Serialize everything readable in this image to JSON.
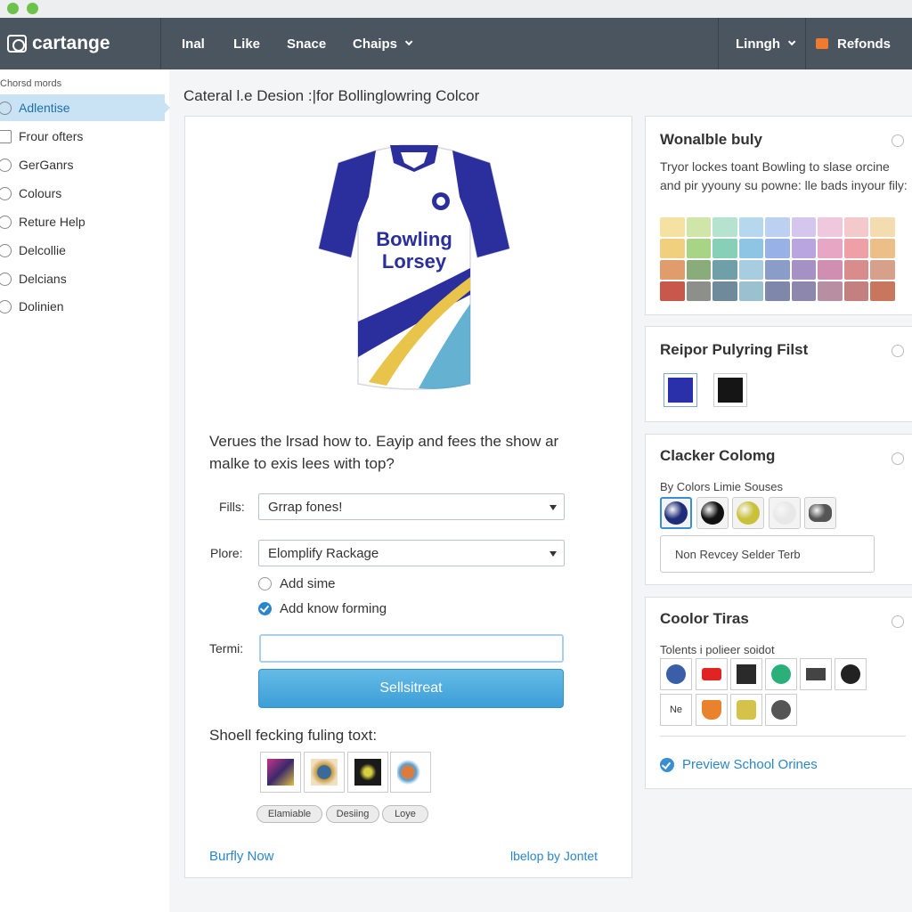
{
  "nav": {
    "brand": "cartange",
    "items": [
      "Inal",
      "Like",
      "Snace",
      "Chaips"
    ],
    "language": "Linngh",
    "refunds": "Refonds"
  },
  "sidebar": {
    "title": "Chorsd mords",
    "items": [
      {
        "label": "Adlentise",
        "icon": "circle-icon"
      },
      {
        "label": "Frour ofters",
        "icon": "grid-icon"
      },
      {
        "label": "GerGanrs",
        "icon": "users-icon"
      },
      {
        "label": "Colours",
        "icon": "palette-icon"
      },
      {
        "label": "Reture Help",
        "icon": "help-icon"
      },
      {
        "label": "Delcollie",
        "icon": "circle-icon"
      },
      {
        "label": "Delcians",
        "icon": "circle-icon"
      },
      {
        "label": "Dolinien",
        "icon": "circle-icon"
      }
    ]
  },
  "page": {
    "title": "Cateral l.e Desion :|for Bollinglowring Colcor"
  },
  "main": {
    "shirt_text_line1": "Bowling",
    "shirt_text_line2": "Lorsey",
    "question": "Verues the lrsad how to. Eayip and fees the show ar malke to exis lees with top?",
    "fills_label": "Fills:",
    "fills_value": "Grrap fones!",
    "plore_label": "Plore:",
    "plore_value": "Elomplify Rackage",
    "radio1": "Add sime",
    "radio2": "Add know forming",
    "term_label": "Termi:",
    "term_value": "",
    "submit_label": "Sellsitreat",
    "samples_title": "Shoell fecking fuling toxt:",
    "tags": [
      "Elamiable",
      "Desiing",
      "Loye"
    ],
    "footer_left": "Burfly Now",
    "footer_right": "lbelop by Jontet"
  },
  "card1": {
    "title": "Wonalble buly",
    "text": "Tryor lockes toant Bowling to slase orcine and pir yyouny su powne: lle bads inyour fily:",
    "palette": [
      "#f5e2a2",
      "#cfe6a8",
      "#b6e3cf",
      "#b5d8ee",
      "#bcd0f2",
      "#d5c6ee",
      "#f0c8dd",
      "#f4c9cc",
      "#f3dcb0",
      "#f0cf7e",
      "#a8d486",
      "#88cfb8",
      "#8ec5e4",
      "#98b1e6",
      "#b9a5e0",
      "#e6a6c4",
      "#ef9fa6",
      "#edbf88",
      "#e09c6a",
      "#89ad7a",
      "#6f9fa8",
      "#a9cde0",
      "#8a9cc8",
      "#a691c4",
      "#d08fb0",
      "#d98c8c",
      "#d7a08a",
      "#c9584c",
      "#8d8f8a",
      "#6f8a9a",
      "#9bc0d0",
      "#7f88ab",
      "#8e87ad",
      "#b88ea2",
      "#c47f7f",
      "#c9765f"
    ]
  },
  "card2": {
    "title": "Reipor Pulyring Filst",
    "swatches": [
      "#2a2faa",
      "#151515"
    ]
  },
  "card3": {
    "title": "Clacker Colomg",
    "subtitle": "By Colors Limie Souses",
    "balls": [
      "#1e2d7a",
      "#111111",
      "#c9c13a",
      "#e8e8e8",
      "#555555"
    ],
    "input_value": "Non Revcey  Selder Terb"
  },
  "card4": {
    "title": "Coolor Tiras",
    "subtitle": "Tolents i polieer soidot",
    "icons_row1": [
      "#3a5fa8",
      "#e02424",
      "#2a2a2a",
      "#2bb07a",
      "#444444",
      "#222222"
    ],
    "icons_row2_label": "Ne",
    "icons_row2": [
      "#e8822c",
      "#d4c24a",
      "#555555"
    ],
    "preview_link": "Preview School Orines"
  }
}
